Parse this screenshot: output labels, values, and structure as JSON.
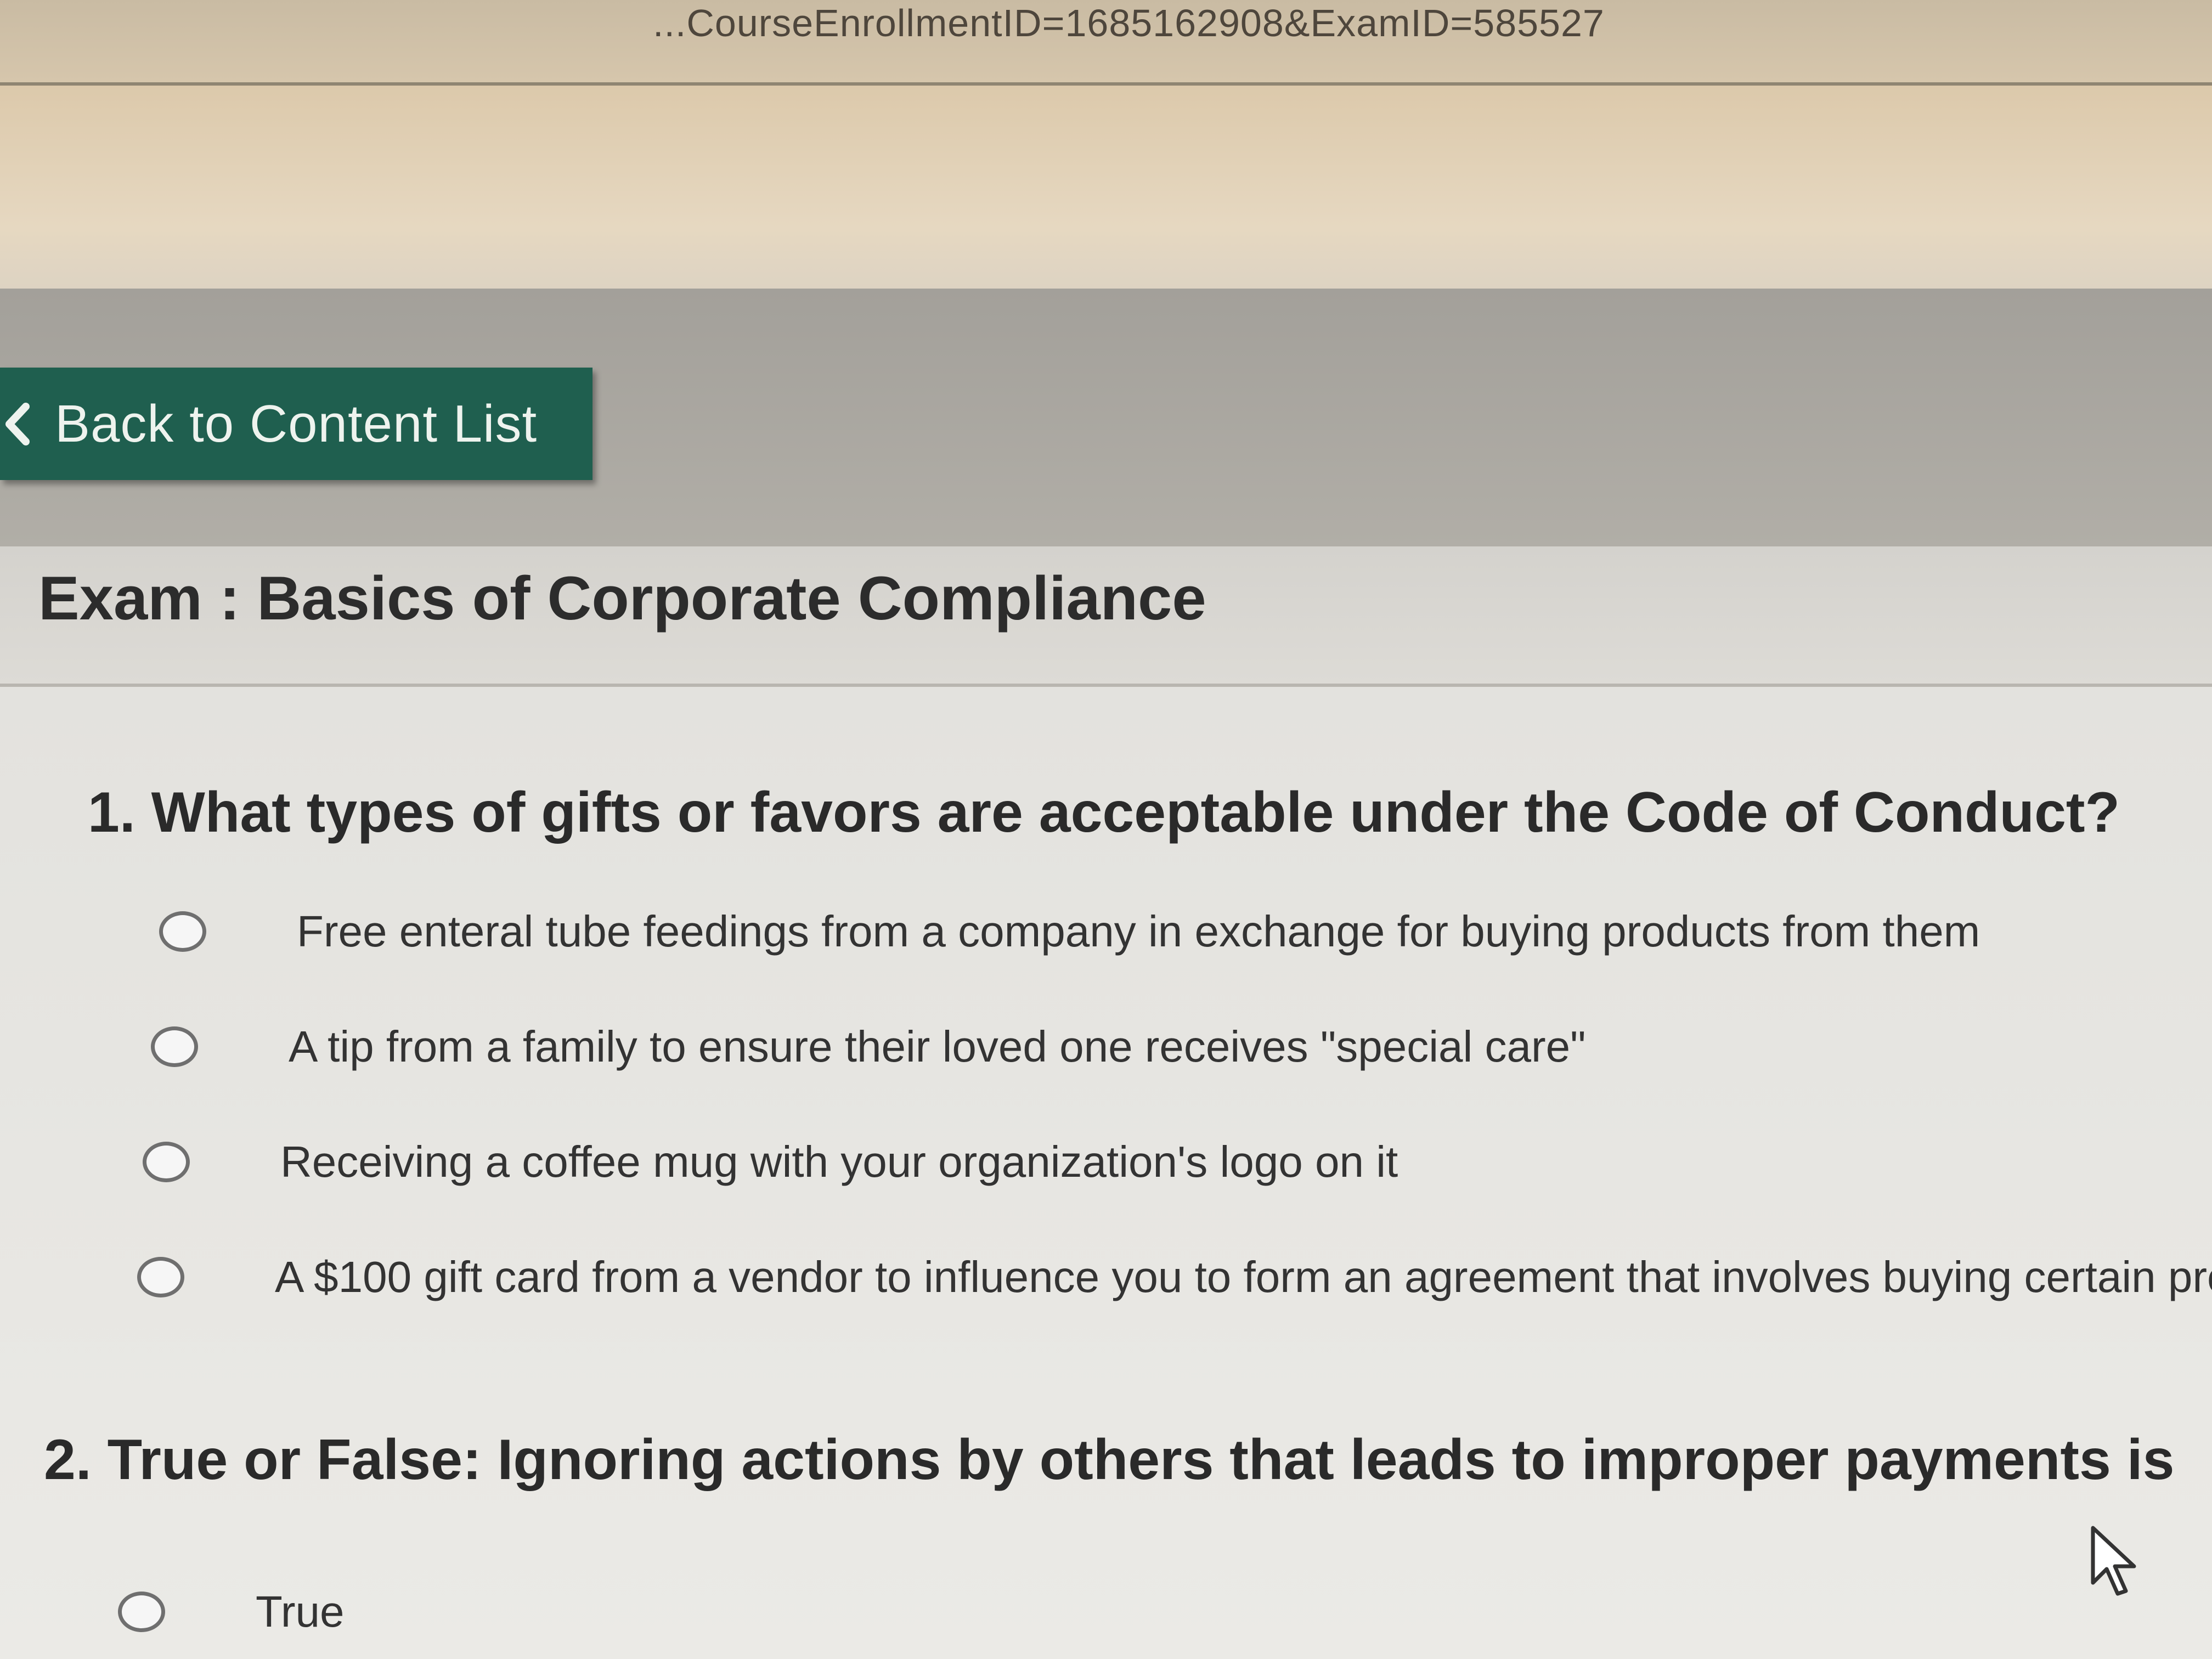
{
  "browser": {
    "url_fragment": "...CourseEnrollmentID=1685162908&ExamID=585527"
  },
  "nav": {
    "back_label": "Back to Content List",
    "back_icon": "chevron-left-icon",
    "accent": "#1f5f4f"
  },
  "exam": {
    "title": "Exam : Basics of Corporate Compliance"
  },
  "questions": [
    {
      "text": "1. What types of gifts or favors are acceptable under the Code of Conduct?",
      "options": [
        "Free enteral tube feedings from a company in exchange for buying products from them",
        "A tip from a family to ensure their loved one receives \"special care\"",
        "Receiving a coffee mug with your organization's logo on it",
        "A $100 gift card from a vendor to influence you to form an agreement that involves buying certain pro"
      ]
    },
    {
      "text": "2. True or False: Ignoring actions by others that leads to improper payments is",
      "options": [
        "True"
      ]
    }
  ],
  "pointer": {
    "icon": "mouse-pointer-icon"
  }
}
